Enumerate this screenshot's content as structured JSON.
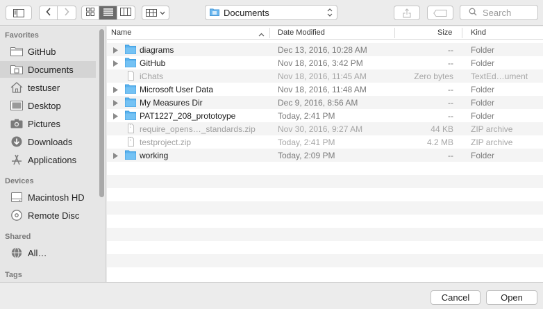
{
  "toolbar": {
    "location": "Documents",
    "search_placeholder": "Search"
  },
  "sidebar": {
    "sections": [
      {
        "heading": "Favorites"
      },
      {
        "heading": "Devices"
      },
      {
        "heading": "Shared"
      },
      {
        "heading": "Tags"
      }
    ],
    "favorites": [
      {
        "label": "GitHub",
        "icon": "folder-icon"
      },
      {
        "label": "Documents",
        "icon": "documents-folder-icon",
        "selected": true
      },
      {
        "label": "testuser",
        "icon": "home-icon"
      },
      {
        "label": "Desktop",
        "icon": "desktop-icon"
      },
      {
        "label": "Pictures",
        "icon": "camera-icon"
      },
      {
        "label": "Downloads",
        "icon": "downloads-icon"
      },
      {
        "label": "Applications",
        "icon": "applications-icon"
      }
    ],
    "devices": [
      {
        "label": "Macintosh HD",
        "icon": "hard-drive-icon"
      },
      {
        "label": "Remote Disc",
        "icon": "disc-icon"
      }
    ],
    "shared": [
      {
        "label": "All…",
        "icon": "network-globe-icon"
      }
    ]
  },
  "columns": {
    "name": "Name",
    "date": "Date Modified",
    "size": "Size",
    "kind": "Kind"
  },
  "files": [
    {
      "name": "diagrams",
      "date": "Dec 13, 2016, 10:28 AM",
      "size": "--",
      "kind": "Folder",
      "type": "folder"
    },
    {
      "name": "GitHub",
      "date": "Nov 18, 2016, 3:42 PM",
      "size": "--",
      "kind": "Folder",
      "type": "folder"
    },
    {
      "name": "iChats",
      "date": "Nov 18, 2016, 11:45 AM",
      "size": "Zero bytes",
      "kind": "TextEd…ument",
      "type": "file"
    },
    {
      "name": "Microsoft User Data",
      "date": "Nov 18, 2016, 11:48 AM",
      "size": "--",
      "kind": "Folder",
      "type": "folder"
    },
    {
      "name": "My Measures Dir",
      "date": "Dec 9, 2016, 8:56 AM",
      "size": "--",
      "kind": "Folder",
      "type": "folder"
    },
    {
      "name": "PAT1227_208_prototoype",
      "date": "Today, 2:41 PM",
      "size": "--",
      "kind": "Folder",
      "type": "folder"
    },
    {
      "name": "require_opens…_standards.zip",
      "date": "Nov 30, 2016, 9:27 AM",
      "size": "44 KB",
      "kind": "ZIP archive",
      "type": "file"
    },
    {
      "name": "testproject.zip",
      "date": "Today, 2:41 PM",
      "size": "4.2 MB",
      "kind": "ZIP archive",
      "type": "file"
    },
    {
      "name": "working",
      "date": "Today, 2:09 PM",
      "size": "--",
      "kind": "Folder",
      "type": "folder"
    }
  ],
  "footer": {
    "cancel": "Cancel",
    "open": "Open"
  },
  "colors": {
    "folder_blue": "#5bb3ee",
    "selection": "#d4d4d4"
  }
}
